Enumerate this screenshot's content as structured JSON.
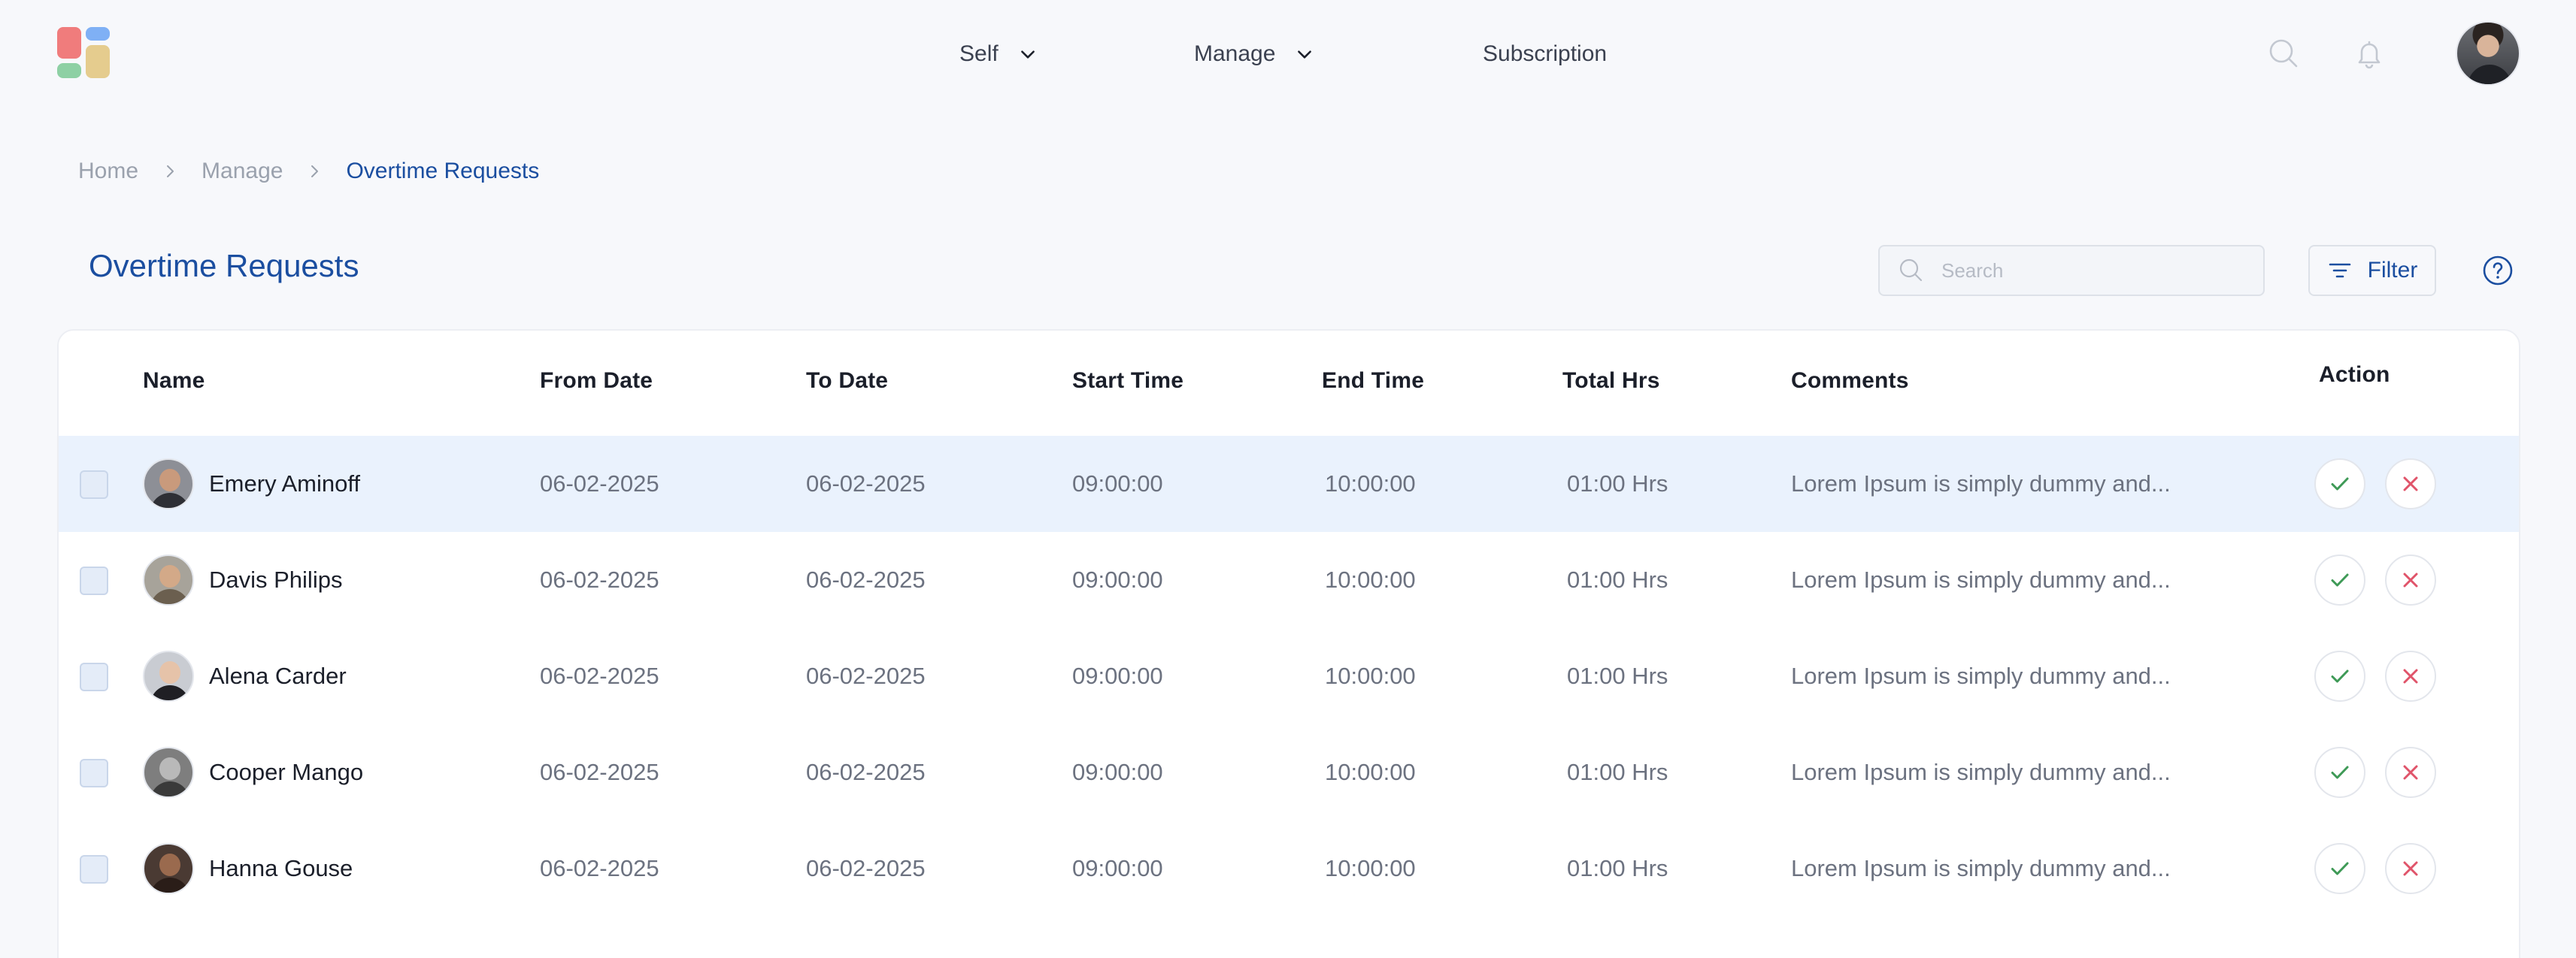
{
  "nav": {
    "items": [
      {
        "label": "Self",
        "has_dropdown": true
      },
      {
        "label": "Manage",
        "has_dropdown": true
      },
      {
        "label": "Subscription",
        "has_dropdown": false
      }
    ],
    "icons": [
      "search-icon",
      "bell-icon"
    ]
  },
  "breadcrumb": {
    "items": [
      "Home",
      "Manage",
      "Overtime Requests"
    ]
  },
  "page": {
    "title": "Overtime Requests",
    "search_placeholder": "Search",
    "filter_label": "Filter"
  },
  "table": {
    "columns": [
      "Name",
      "From Date",
      "To Date",
      "Start Time",
      "End Time",
      "Total Hrs",
      "Comments",
      "Action"
    ],
    "rows": [
      {
        "name": "Emery Aminoff",
        "from": "06-02-2025",
        "to": "06-02-2025",
        "start": "09:00:00",
        "end": "10:00:00",
        "total": "01:00 Hrs",
        "comment": "Lorem Ipsum is simply dummy and...",
        "highlighted": true
      },
      {
        "name": "Davis Philips",
        "from": "06-02-2025",
        "to": "06-02-2025",
        "start": "09:00:00",
        "end": "10:00:00",
        "total": "01:00 Hrs",
        "comment": "Lorem Ipsum is simply dummy and...",
        "highlighted": false
      },
      {
        "name": "Alena Carder",
        "from": "06-02-2025",
        "to": "06-02-2025",
        "start": "09:00:00",
        "end": "10:00:00",
        "total": "01:00 Hrs",
        "comment": "Lorem Ipsum is simply dummy and...",
        "highlighted": false
      },
      {
        "name": "Cooper Mango",
        "from": "06-02-2025",
        "to": "06-02-2025",
        "start": "09:00:00",
        "end": "10:00:00",
        "total": "01:00 Hrs",
        "comment": "Lorem Ipsum is simply dummy and...",
        "highlighted": false
      },
      {
        "name": "Hanna Gouse",
        "from": "06-02-2025",
        "to": "06-02-2025",
        "start": "09:00:00",
        "end": "10:00:00",
        "total": "01:00 Hrs",
        "comment": "Lorem Ipsum is simply dummy and...",
        "highlighted": false
      }
    ]
  },
  "colors": {
    "accent": "#1b4ea0",
    "approve": "#3f9a57",
    "reject": "#e0546a",
    "row_highlight": "#eaf2fd"
  }
}
